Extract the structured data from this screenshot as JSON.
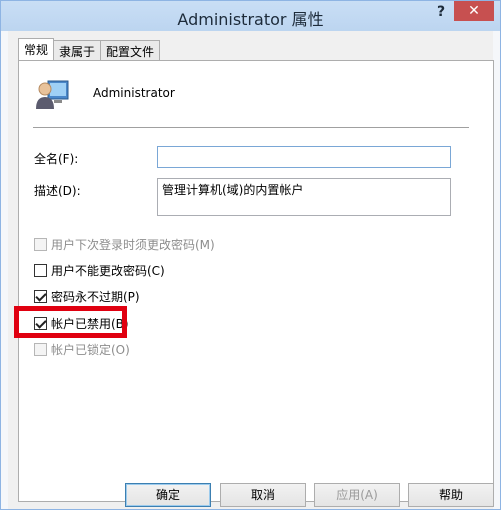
{
  "window": {
    "title": "Administrator 属性",
    "help": "?",
    "close": "✕"
  },
  "tabs": [
    {
      "label": "常规",
      "active": true
    },
    {
      "label": "隶属于",
      "active": false
    },
    {
      "label": "配置文件",
      "active": false
    }
  ],
  "user": {
    "name": "Administrator"
  },
  "fields": {
    "fullname_label": "全名(F):",
    "fullname_value": "",
    "description_label": "描述(D):",
    "description_value": "管理计算机(域)的内置帐户"
  },
  "checkboxes": [
    {
      "label": "用户下次登录时须更改密码(M)",
      "checked": false,
      "enabled": false
    },
    {
      "label": "用户不能更改密码(C)",
      "checked": false,
      "enabled": true
    },
    {
      "label": "密码永不过期(P)",
      "checked": true,
      "enabled": true
    },
    {
      "label": "帐户已禁用(B)",
      "checked": true,
      "enabled": true
    },
    {
      "label": "帐户已锁定(O)",
      "checked": false,
      "enabled": false
    }
  ],
  "buttons": {
    "ok": "确定",
    "cancel": "取消",
    "apply": "应用(A)",
    "help": "帮助"
  },
  "colors": {
    "highlight": "#e00010",
    "accent": "#7aa7d6"
  }
}
